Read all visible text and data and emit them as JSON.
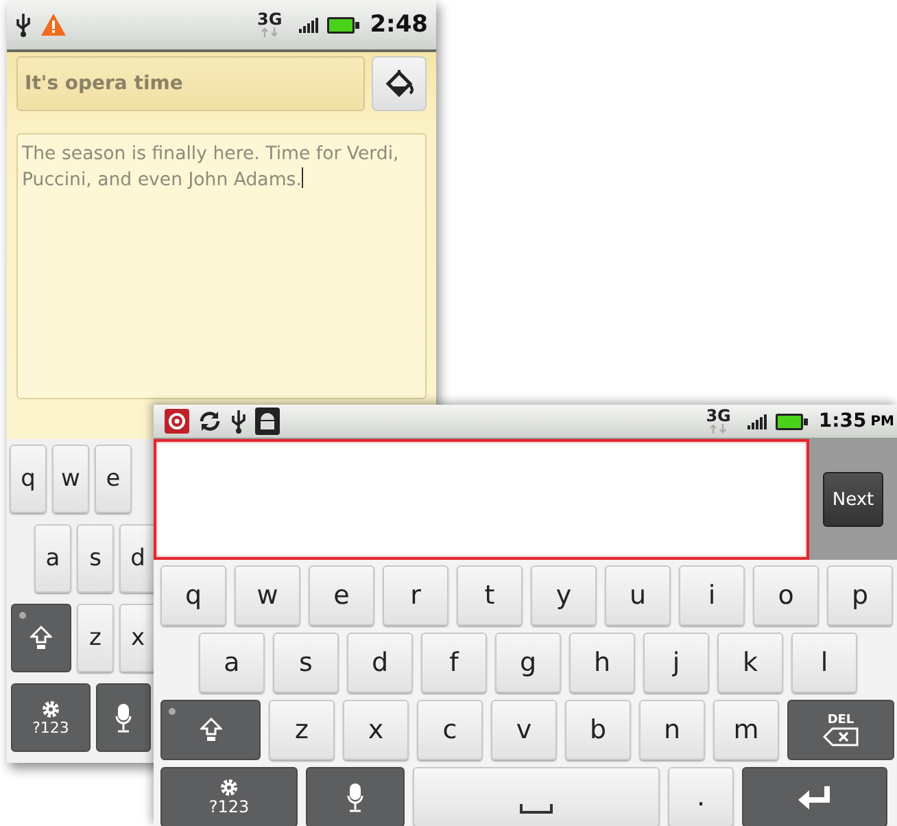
{
  "back_phone": {
    "status_bar": {
      "network": "3G",
      "time": "2:48"
    },
    "title_field": {
      "value": "It's opera time"
    },
    "body_field": {
      "value": "The season is finally here. Time for Verdi, Puccini, and even John Adams."
    },
    "keyboard": {
      "rows": [
        [
          {
            "kind": "letter",
            "label": "q"
          },
          {
            "kind": "letter",
            "label": "w"
          },
          {
            "kind": "letter",
            "label": "e"
          }
        ],
        [
          {
            "kind": "letter",
            "label": "a"
          },
          {
            "kind": "letter",
            "label": "s"
          },
          {
            "kind": "letter",
            "label": "d"
          }
        ],
        [
          {
            "kind": "shift"
          },
          {
            "kind": "letter",
            "label": "z"
          },
          {
            "kind": "letter",
            "label": "x"
          }
        ],
        [
          {
            "kind": "symbols",
            "label": "?123"
          },
          {
            "kind": "mic"
          }
        ]
      ]
    }
  },
  "front_phone": {
    "status_bar": {
      "network": "3G",
      "time": "1:35",
      "time_suffix": "PM"
    },
    "next_button": {
      "label": "Next"
    },
    "keyboard": {
      "rows": [
        [
          {
            "kind": "letter",
            "label": "q"
          },
          {
            "kind": "letter",
            "label": "w"
          },
          {
            "kind": "letter",
            "label": "e"
          },
          {
            "kind": "letter",
            "label": "r"
          },
          {
            "kind": "letter",
            "label": "t"
          },
          {
            "kind": "letter",
            "label": "y"
          },
          {
            "kind": "letter",
            "label": "u"
          },
          {
            "kind": "letter",
            "label": "i"
          },
          {
            "kind": "letter",
            "label": "o"
          },
          {
            "kind": "letter",
            "label": "p"
          }
        ],
        [
          {
            "kind": "letter",
            "label": "a"
          },
          {
            "kind": "letter",
            "label": "s"
          },
          {
            "kind": "letter",
            "label": "d"
          },
          {
            "kind": "letter",
            "label": "f"
          },
          {
            "kind": "letter",
            "label": "g"
          },
          {
            "kind": "letter",
            "label": "h"
          },
          {
            "kind": "letter",
            "label": "j"
          },
          {
            "kind": "letter",
            "label": "k"
          },
          {
            "kind": "letter",
            "label": "l"
          }
        ],
        [
          {
            "kind": "shift"
          },
          {
            "kind": "letter",
            "label": "z"
          },
          {
            "kind": "letter",
            "label": "x"
          },
          {
            "kind": "letter",
            "label": "c"
          },
          {
            "kind": "letter",
            "label": "v"
          },
          {
            "kind": "letter",
            "label": "b"
          },
          {
            "kind": "letter",
            "label": "n"
          },
          {
            "kind": "letter",
            "label": "m"
          },
          {
            "kind": "delete",
            "label": "DEL"
          }
        ],
        [
          {
            "kind": "symbols",
            "label": "?123"
          },
          {
            "kind": "mic"
          },
          {
            "kind": "space"
          },
          {
            "kind": "letter",
            "label": "."
          },
          {
            "kind": "enter"
          }
        ]
      ]
    }
  }
}
